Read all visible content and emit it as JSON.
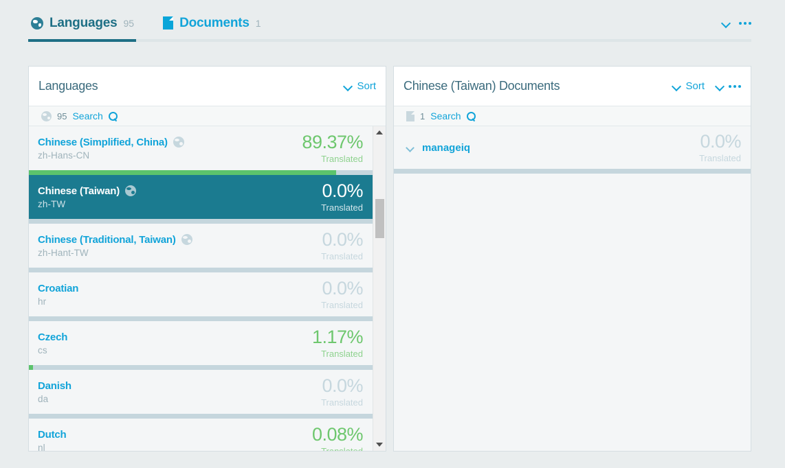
{
  "tabs": [
    {
      "label": "Languages",
      "count": "95",
      "icon": "globe-icon",
      "active": true
    },
    {
      "label": "Documents",
      "count": "1",
      "icon": "document-icon",
      "active": false
    }
  ],
  "tab_actions": {
    "chevron": "chevron-down-icon",
    "menu": "kebab-menu-icon"
  },
  "languages_panel": {
    "title": "Languages",
    "sort_label": "Sort",
    "search": {
      "count": "95",
      "link": "Search",
      "icon": "globe-icon",
      "search_icon": "search-icon"
    },
    "rows": [
      {
        "name": "Chinese (Simplified, China)",
        "code": "zh-Hans-CN",
        "percent": "89.37%",
        "translated": "Translated",
        "progress": 89.37,
        "has_globe": true,
        "selected": false
      },
      {
        "name": "Chinese (Taiwan)",
        "code": "zh-TW",
        "percent": "0.0%",
        "translated": "Translated",
        "progress": 0,
        "has_globe": true,
        "selected": true
      },
      {
        "name": "Chinese (Traditional, Taiwan)",
        "code": "zh-Hant-TW",
        "percent": "0.0%",
        "translated": "Translated",
        "progress": 0,
        "has_globe": true,
        "selected": false
      },
      {
        "name": "Croatian",
        "code": "hr",
        "percent": "0.0%",
        "translated": "Translated",
        "progress": 0,
        "has_globe": false,
        "selected": false
      },
      {
        "name": "Czech",
        "code": "cs",
        "percent": "1.17%",
        "translated": "Translated",
        "progress": 1.17,
        "has_globe": false,
        "selected": false
      },
      {
        "name": "Danish",
        "code": "da",
        "percent": "0.0%",
        "translated": "Translated",
        "progress": 0,
        "has_globe": false,
        "selected": false
      },
      {
        "name": "Dutch",
        "code": "nl",
        "percent": "0.08%",
        "translated": "Translated",
        "progress": 0.08,
        "has_globe": false,
        "selected": false
      }
    ]
  },
  "documents_panel": {
    "title": "Chinese (Taiwan) Documents",
    "sort_label": "Sort",
    "search": {
      "count": "1",
      "link": "Search",
      "icon": "document-icon",
      "search_icon": "search-icon"
    },
    "rows": [
      {
        "name": "manageiq",
        "percent": "0.0%",
        "translated": "Translated",
        "progress": 0
      }
    ]
  },
  "colors": {
    "page_bg": "#e9edee",
    "accent_blue": "#12a4d9",
    "title_teal": "#3b6b7d",
    "selected_teal": "#1b7b90",
    "progress_green": "#5cc36c",
    "progress_track": "#c5d6dd"
  }
}
